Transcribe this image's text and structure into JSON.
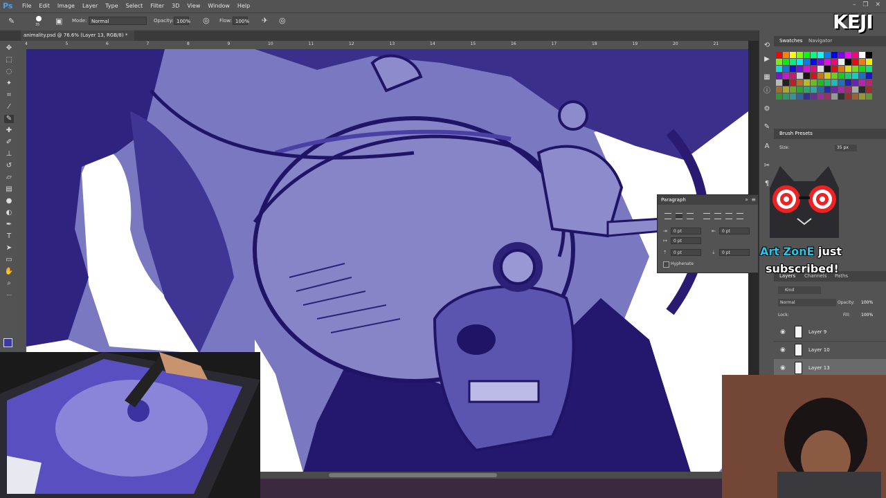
{
  "app": {
    "logo": "Ps"
  },
  "menu": [
    "File",
    "Edit",
    "Image",
    "Layer",
    "Type",
    "Select",
    "Filter",
    "3D",
    "View",
    "Window",
    "Help"
  ],
  "options_bar": {
    "brush_size": "35",
    "mode_label": "Mode:",
    "mode_value": "Normal",
    "opacity_label": "Opacity:",
    "opacity_value": "100%",
    "flow_label": "Flow:",
    "flow_value": "100%"
  },
  "document": {
    "tab_title": "animality.psd @ 76.6% (Layer 13, RGB/8) *"
  },
  "ruler": {
    "ticks": [
      "4",
      "5",
      "6",
      "7",
      "8",
      "9",
      "10",
      "11",
      "12",
      "13",
      "14",
      "15",
      "16",
      "17",
      "18",
      "19",
      "20",
      "21"
    ]
  },
  "panels": {
    "swatches": {
      "tabs": [
        "Swatches",
        "Navigator"
      ]
    },
    "brush_presets": {
      "title": "Brush Presets",
      "size_label": "Size:",
      "size_value": "35 px"
    },
    "paragraph": {
      "title": "Paragraph",
      "indent_left": "0 pt",
      "indent_right": "0 pt",
      "first_line": "0 pt",
      "space_before": "0 pt",
      "space_after": "0 pt",
      "hyphenate_label": "Hyphenate"
    },
    "layers": {
      "tabs": [
        "Layers",
        "Channels",
        "Paths"
      ],
      "filter_label": "Kind",
      "blend_mode": "Normal",
      "opacity_label": "Opacity:",
      "opacity_value": "100%",
      "lock_label": "Lock:",
      "fill_label": "Fill:",
      "fill_value": "100%",
      "items": [
        {
          "name": "Layer 9"
        },
        {
          "name": "Layer 10"
        },
        {
          "name": "Layer 13"
        }
      ]
    }
  },
  "overlays": {
    "channel_logo": "KEJI",
    "subscriber_name": "Art ZonE",
    "subscriber_line1_rest": "just",
    "subscriber_line2": "subscribed!"
  },
  "colors": {
    "ui_panel": "#535353",
    "ink_dark": "#2a1a72",
    "ink_light": "#7a78c0",
    "accent_blue": "#29c4e6"
  }
}
